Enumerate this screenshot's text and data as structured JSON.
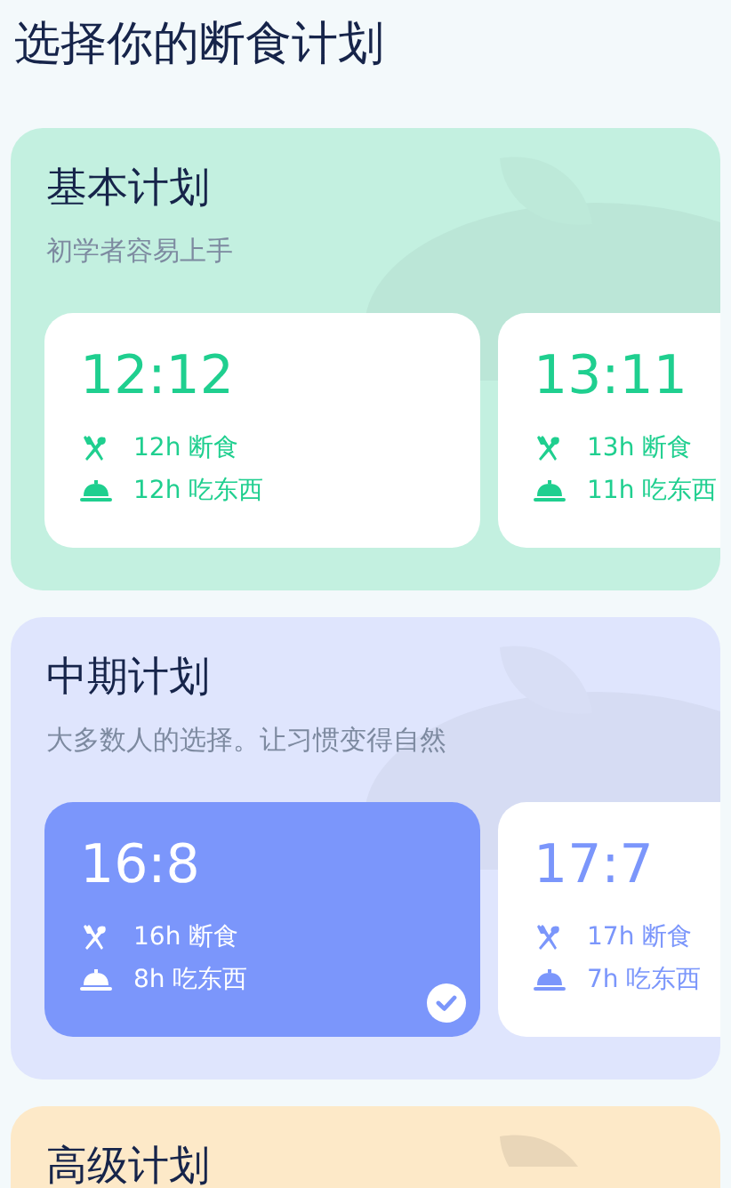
{
  "page_title": "选择你的断食计划",
  "sections": [
    {
      "title": "基本计划",
      "subtitle": "初学者容易上手",
      "color": "#c3f0e0",
      "plans": [
        {
          "ratio": "12:12",
          "fasting": "12h 断食",
          "eating": "12h 吃东西",
          "selected": false,
          "color": "#1fcf8f"
        },
        {
          "ratio": "13:11",
          "fasting": "13h 断食",
          "eating": "11h 吃东西",
          "selected": false,
          "color": "#1fcf8f"
        }
      ]
    },
    {
      "title": "中期计划",
      "subtitle": "大多数人的选择。让习惯变得自然",
      "color": "#dfe5fd",
      "plans": [
        {
          "ratio": "16:8",
          "fasting": "16h 断食",
          "eating": "8h 吃东西",
          "selected": true,
          "color": "#7b96fb"
        },
        {
          "ratio": "17:7",
          "fasting": "17h 断食",
          "eating": "7h 吃东西",
          "selected": false,
          "color": "#7b96fb"
        }
      ]
    },
    {
      "title": "高级计划",
      "color": "#fde9c8"
    }
  ]
}
